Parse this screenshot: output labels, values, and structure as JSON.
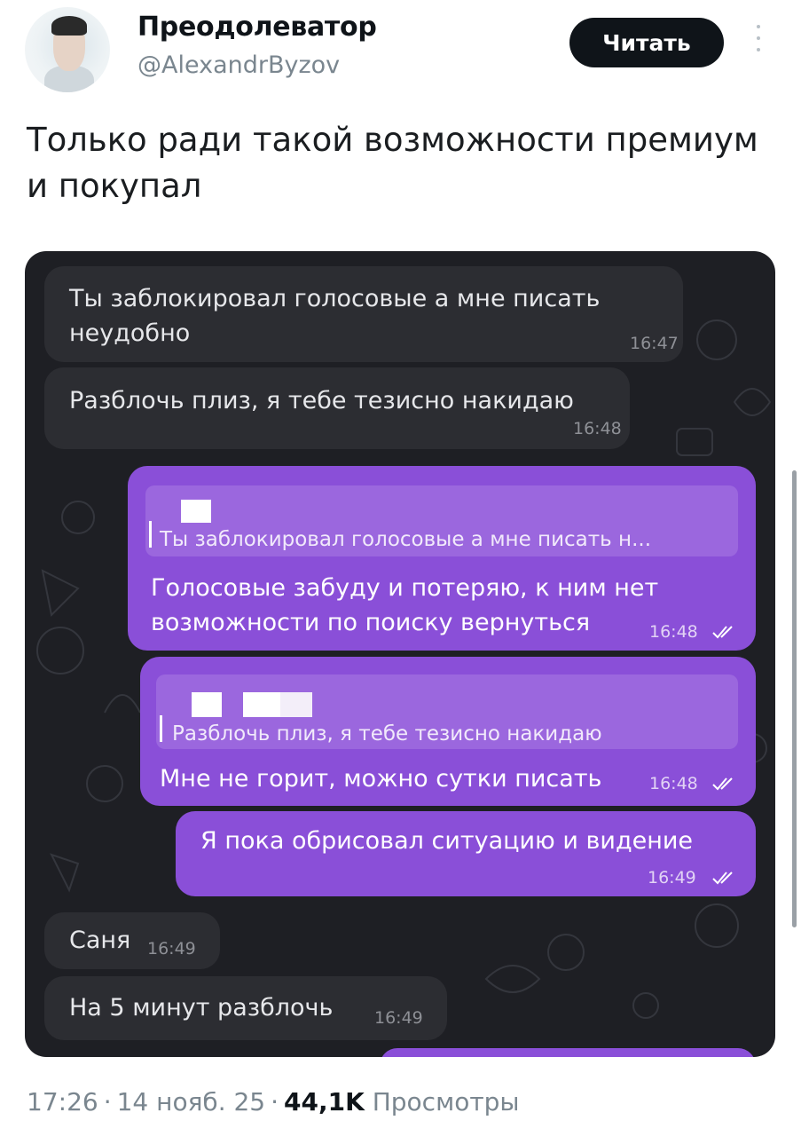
{
  "author": {
    "display_name": "Преодолеватор",
    "handle": "@AlexandrByzov",
    "follow_label": "Читать"
  },
  "tweet": {
    "text": "Только ради такой возможности премиум и покупал"
  },
  "chat": {
    "messages": [
      {
        "side": "in",
        "lines": [
          "Ты заблокировал голосовые а мне писать",
          "неудобно"
        ],
        "time": "16:47"
      },
      {
        "side": "in",
        "lines": [
          "Разблочь плиз,  я тебе тезисно накидаю"
        ],
        "time": "16:48"
      },
      {
        "side": "out",
        "quote": "Ты заблокировал голосовые а мне писать н...",
        "lines": [
          "Голосовые забуду и потеряю, к ним нет",
          "возможности по поиску вернуться"
        ],
        "time": "16:48"
      },
      {
        "side": "out",
        "quote": "Разблочь плиз,  я тебе тезисно накидаю",
        "lines": [
          "Мне не горит, можно сутки писать"
        ],
        "time": "16:48"
      },
      {
        "side": "out",
        "lines": [
          "Я пока обрисовал ситуацию и видение"
        ],
        "time": "16:49"
      },
      {
        "side": "in",
        "lines": [
          "Саня"
        ],
        "time": "16:49"
      },
      {
        "side": "in",
        "lines": [
          "На 5 минут разблочь"
        ],
        "time": "16:49"
      }
    ],
    "colors": {
      "background": "#1e1f24",
      "incoming": "#2c2d32",
      "outgoing": "#8a4fd8"
    }
  },
  "meta": {
    "time": "17:26",
    "date": "14 нояб. 25",
    "views_count": "44,1K",
    "views_label": "Просмотры"
  }
}
